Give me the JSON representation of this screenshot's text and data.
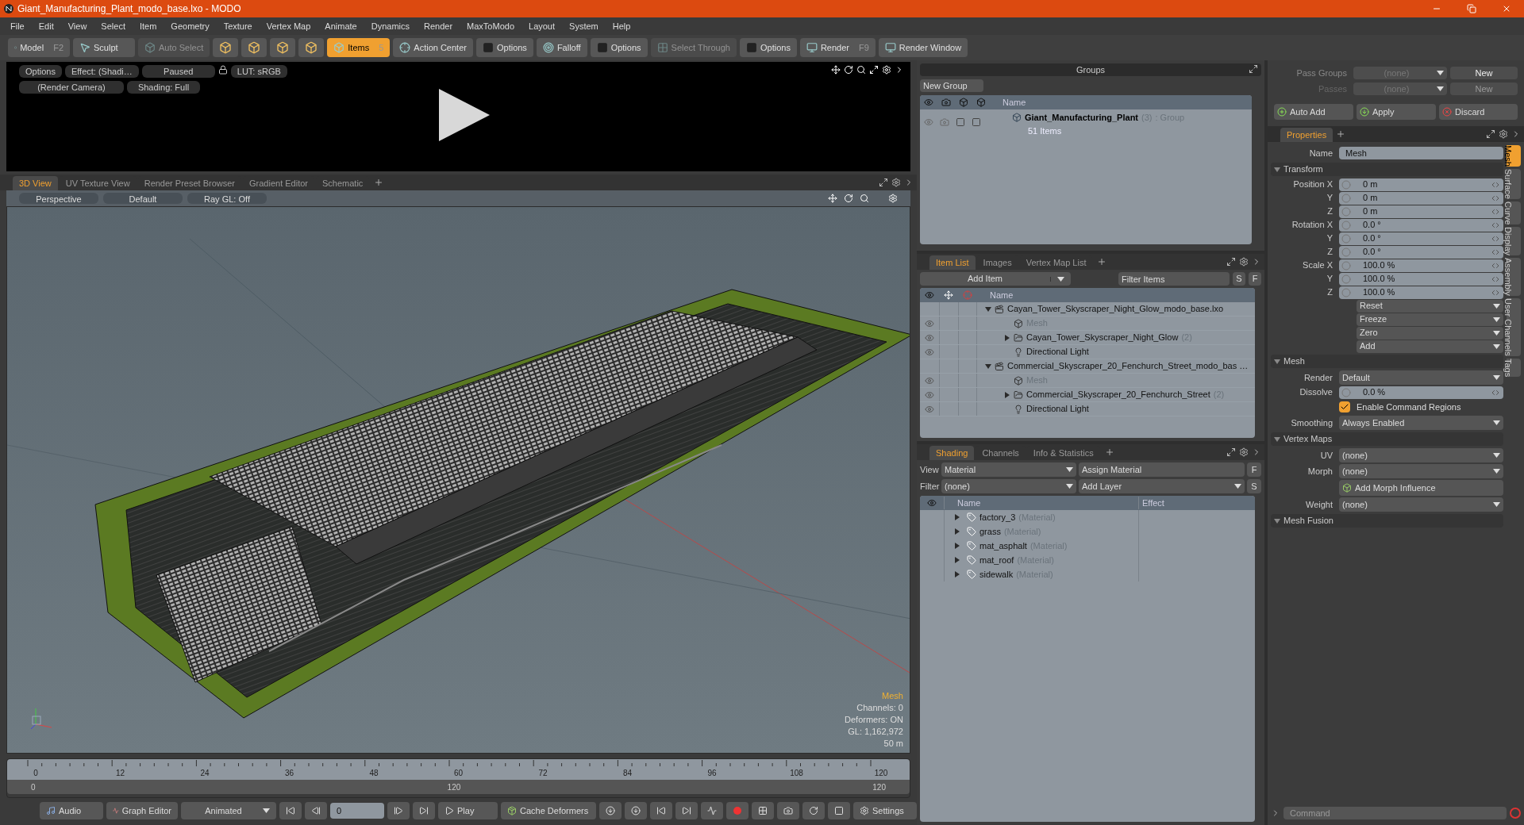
{
  "window": {
    "title": "Giant_Manufacturing_Plant_modo_base.lxo - MODO"
  },
  "menu": [
    "File",
    "Edit",
    "View",
    "Select",
    "Item",
    "Geometry",
    "Texture",
    "Vertex Map",
    "Animate",
    "Dynamics",
    "Render",
    "MaxToModo",
    "Layout",
    "System",
    "Help"
  ],
  "toolbar": [
    {
      "kind": "mode",
      "label": "Model",
      "shortcut": "F2",
      "selected": false,
      "disabled": false
    },
    {
      "kind": "mode",
      "label": "Sculpt",
      "selected": false,
      "disabled": false
    },
    {
      "kind": "button",
      "label": "Auto Select",
      "selected": false,
      "disabled": true
    },
    {
      "kind": "icon",
      "selected": false,
      "disabled": false
    },
    {
      "kind": "icon",
      "selected": false,
      "disabled": false
    },
    {
      "kind": "icon",
      "selected": false,
      "disabled": false
    },
    {
      "kind": "icon",
      "selected": false,
      "disabled": false
    },
    {
      "kind": "button",
      "label": "Items",
      "shortcut": "5",
      "selected": true,
      "disabled": false
    },
    {
      "kind": "button",
      "label": "Action Center",
      "selected": false,
      "disabled": false
    },
    {
      "kind": "toggle",
      "label": "Options",
      "selected": false,
      "disabled": false
    },
    {
      "kind": "button",
      "label": "Falloff",
      "selected": false,
      "disabled": false
    },
    {
      "kind": "toggle",
      "label": "Options",
      "selected": false,
      "disabled": false
    },
    {
      "kind": "button",
      "label": "Select Through",
      "selected": false,
      "disabled": true
    },
    {
      "kind": "toggle",
      "label": "Options",
      "selected": false,
      "disabled": false
    },
    {
      "kind": "button",
      "label": "Render",
      "shortcut": "F9",
      "selected": false,
      "disabled": false
    },
    {
      "kind": "button",
      "label": "Render Window",
      "selected": false,
      "disabled": false
    }
  ],
  "preview": {
    "row_1": [
      "Options",
      "Effect: (Shadi…",
      "Paused",
      "LUT: sRGB"
    ],
    "row_2": [
      "(Render Camera)",
      "Shading: Full"
    ]
  },
  "viewport_tabs": [
    {
      "label": "3D View",
      "selected": true
    },
    {
      "label": "UV Texture View",
      "selected": false
    },
    {
      "label": "Render Preset Browser",
      "selected": false
    },
    {
      "label": "Gradient Editor",
      "selected": false
    },
    {
      "label": "Schematic",
      "selected": false
    }
  ],
  "viewport_bar": [
    "Perspective",
    "Default",
    "Ray GL: Off"
  ],
  "viewport_info": {
    "item": "Mesh",
    "lines": [
      "Channels: 0",
      "Deformers: ON",
      "GL: 1,162,972",
      "50 m"
    ]
  },
  "timeline": {
    "ticks": [
      "0",
      "12",
      "24",
      "36",
      "48",
      "60",
      "72",
      "84",
      "96",
      "108",
      "120"
    ],
    "range_start": "0",
    "range_mid": "120",
    "range_end": "120"
  },
  "transport": {
    "audio": "Audio",
    "graph_editor": "Graph Editor",
    "mode": "Animated",
    "frame": "0",
    "play": "Play",
    "cache": "Cache Deformers",
    "settings": "Settings"
  },
  "groups": {
    "title": "Groups",
    "new_button": "New Group",
    "column": "Name",
    "rows": [
      {
        "name": "Giant_Manufacturing_Plant",
        "count": "(3)",
        "type": ": Group",
        "detail": "51 Items"
      }
    ]
  },
  "item_list": {
    "tabs": [
      {
        "label": "Item List",
        "selected": true
      },
      {
        "label": "Images",
        "selected": false
      },
      {
        "label": "Vertex Map List",
        "selected": false
      }
    ],
    "add_button": "Add Item",
    "filter_placeholder": "Filter Items",
    "s_button": "S",
    "f_button": "F",
    "column": "Name",
    "items": [
      {
        "kind": "scene",
        "name": "Cayan_Tower_Skyscraper_Night_Glow_modo_base.lxo",
        "expanded": true,
        "children": [
          {
            "kind": "mesh",
            "name": "Mesh",
            "disabled": true
          },
          {
            "kind": "group",
            "name": "Cayan_Tower_Skyscraper_Night_Glow",
            "count": "(2)",
            "expanded": false,
            "disabled": false
          },
          {
            "kind": "light",
            "name": "Directional Light",
            "disabled": false
          }
        ]
      },
      {
        "kind": "scene",
        "name": "Commercial_Skyscraper_20_Fenchurch_Street_modo_bas …",
        "expanded": true,
        "children": [
          {
            "kind": "mesh",
            "name": "Mesh",
            "disabled": true
          },
          {
            "kind": "group",
            "name": "Commercial_Skyscraper_20_Fenchurch_Street",
            "count": "(2)",
            "expanded": false,
            "disabled": false
          },
          {
            "kind": "light",
            "name": "Directional Light",
            "disabled": false
          }
        ]
      }
    ]
  },
  "shading": {
    "tabs": [
      {
        "label": "Shading",
        "selected": true
      },
      {
        "label": "Channels",
        "selected": false
      },
      {
        "label": "Info & Statistics",
        "selected": false
      }
    ],
    "view_label": "View",
    "view_value": "Material",
    "assign_button": "Assign Material",
    "f_button": "F",
    "filter_label": "Filter",
    "filter_value": "(none)",
    "add_layer": "Add Layer",
    "s_button": "S",
    "columns": [
      "Name",
      "Effect"
    ],
    "rows": [
      {
        "name": "factory_3",
        "type": "(Material)",
        "expanded": false
      },
      {
        "name": "grass",
        "type": "(Material)",
        "expanded": false
      },
      {
        "name": "mat_asphalt",
        "type": "(Material)",
        "expanded": false
      },
      {
        "name": "mat_roof",
        "type": "(Material)",
        "expanded": false
      },
      {
        "name": "sidewalk",
        "type": "(Material)",
        "expanded": false
      }
    ]
  },
  "passes": {
    "rows": [
      {
        "label": "Pass Groups",
        "value": "(none)",
        "button": "New",
        "disabled": false
      },
      {
        "label": "Passes",
        "value": "(none)",
        "button": "New",
        "disabled": true
      }
    ],
    "auto_add": "Auto Add",
    "apply": "Apply",
    "discard": "Discard"
  },
  "properties": {
    "tab": "Properties",
    "name_label": "Name",
    "name_value": "Mesh",
    "side_tabs": [
      {
        "label": "Mesh",
        "selected": true
      },
      {
        "label": "Surface",
        "selected": false
      },
      {
        "label": "Curve",
        "selected": false
      },
      {
        "label": "Display",
        "selected": false
      },
      {
        "label": "Assembly",
        "selected": false
      },
      {
        "label": "User Channels",
        "selected": false
      },
      {
        "label": "Tags",
        "selected": false
      }
    ],
    "sections": [
      {
        "title": "Transform",
        "expanded": true,
        "rows": [
          {
            "kind": "number",
            "label": "Position X",
            "value": "0 m"
          },
          {
            "kind": "number",
            "label": "Y",
            "value": "0 m"
          },
          {
            "kind": "number",
            "label": "Z",
            "value": "0 m"
          },
          {
            "kind": "number",
            "label": "Rotation X",
            "value": "0.0 °"
          },
          {
            "kind": "number",
            "label": "Y",
            "value": "0.0 °"
          },
          {
            "kind": "number",
            "label": "Z",
            "value": "0.0 °"
          },
          {
            "kind": "number",
            "label": "Scale X",
            "value": "100.0 %"
          },
          {
            "kind": "number",
            "label": "Y",
            "value": "100.0 %"
          },
          {
            "kind": "number",
            "label": "Z",
            "value": "100.0 %"
          },
          {
            "kind": "menu",
            "value": "Reset"
          },
          {
            "kind": "menu",
            "value": "Freeze"
          },
          {
            "kind": "menu",
            "value": "Zero"
          },
          {
            "kind": "menu",
            "value": "Add"
          }
        ]
      },
      {
        "title": "Mesh",
        "expanded": true,
        "rows": [
          {
            "kind": "select",
            "label": "Render",
            "value": "Default"
          },
          {
            "kind": "number",
            "label": "Dissolve",
            "value": "0.0 %"
          },
          {
            "kind": "checkbox",
            "value": "Enable Command Regions",
            "checked": true
          },
          {
            "kind": "select",
            "label": "Smoothing",
            "value": "Always Enabled"
          }
        ]
      },
      {
        "title": "Vertex Maps",
        "expanded": true,
        "rows": [
          {
            "kind": "select",
            "label": "UV",
            "value": "(none)"
          },
          {
            "kind": "select",
            "label": "Morph",
            "value": "(none)"
          },
          {
            "kind": "button",
            "value": "Add Morph Influence"
          },
          {
            "kind": "select",
            "label": "Weight",
            "value": "(none)"
          }
        ]
      },
      {
        "title": "Mesh Fusion",
        "expanded": true
      }
    ]
  },
  "command": {
    "placeholder": "Command"
  }
}
